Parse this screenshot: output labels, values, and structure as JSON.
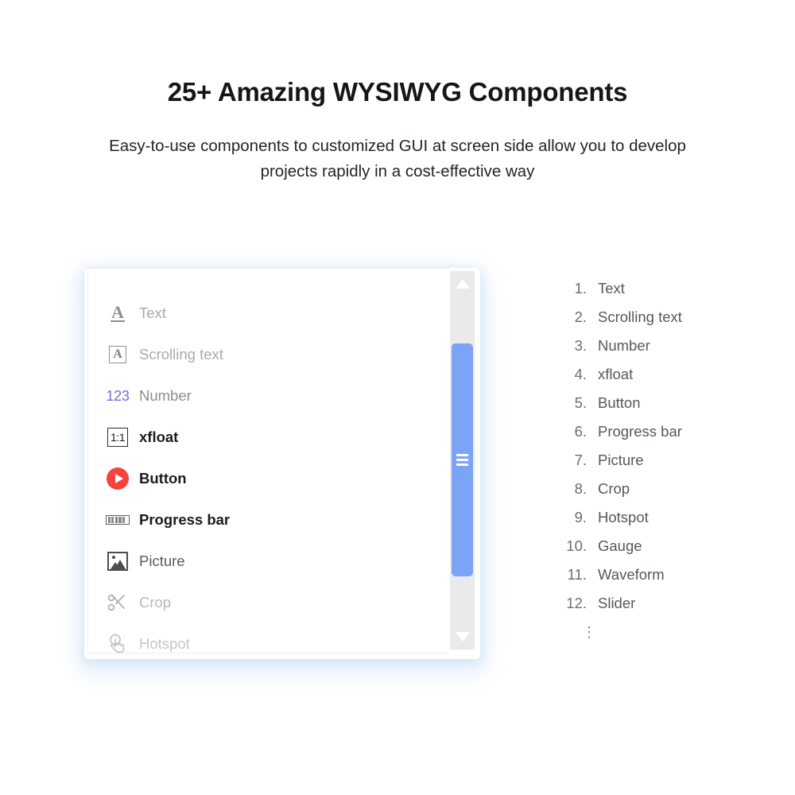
{
  "header": {
    "title": "25+ Amazing WYSIWYG Components",
    "subtitle": "Easy-to-use components to customized GUI at screen side allow you to develop projects rapidly in a cost-effective way"
  },
  "palette": {
    "accent_blue": "#7ba4f6",
    "accent_red": "#f4433c",
    "number_purple": "#6f6fe0",
    "track_gray": "#eaeaec",
    "glow_blue": "#76b2eb"
  },
  "panel": {
    "items": [
      {
        "icon": "text-a-underline-icon",
        "label": "Text"
      },
      {
        "icon": "scrolling-text-a-box-icon",
        "label": "Scrolling text"
      },
      {
        "icon": "number-123-icon",
        "label": "Number"
      },
      {
        "icon": "xfloat-ratio-1-1-icon",
        "label": "xfloat"
      },
      {
        "icon": "button-play-circle-icon",
        "label": "Button"
      },
      {
        "icon": "progress-bar-icon",
        "label": "Progress bar"
      },
      {
        "icon": "picture-image-icon",
        "label": "Picture"
      },
      {
        "icon": "crop-scissors-icon",
        "label": "Crop"
      },
      {
        "icon": "hotspot-hand-pointer-icon",
        "label": "Hotspot"
      }
    ],
    "icon_glyphs": {
      "text_letter": "A",
      "scrolling_letter": "A",
      "number_digits": "123",
      "ratio_text": "1:1"
    },
    "scrollbar": {
      "up_arrow": "scroll-up-arrow-icon",
      "down_arrow": "scroll-down-arrow-icon",
      "thumb": "scroll-thumb-grip"
    }
  },
  "component_list": {
    "items": [
      {
        "index": "1.",
        "label": "Text"
      },
      {
        "index": "2.",
        "label": "Scrolling text"
      },
      {
        "index": "3.",
        "label": "Number"
      },
      {
        "index": "4.",
        "label": "xfloat"
      },
      {
        "index": "5.",
        "label": "Button"
      },
      {
        "index": "6.",
        "label": "Progress bar"
      },
      {
        "index": "7.",
        "label": "Picture"
      },
      {
        "index": "8.",
        "label": "Crop"
      },
      {
        "index": "9.",
        "label": "Hotspot"
      },
      {
        "index": "10.",
        "label": "Gauge"
      },
      {
        "index": "11.",
        "label": "Waveform"
      },
      {
        "index": "12.",
        "label": "Slider"
      }
    ],
    "continuation": "⋮"
  }
}
